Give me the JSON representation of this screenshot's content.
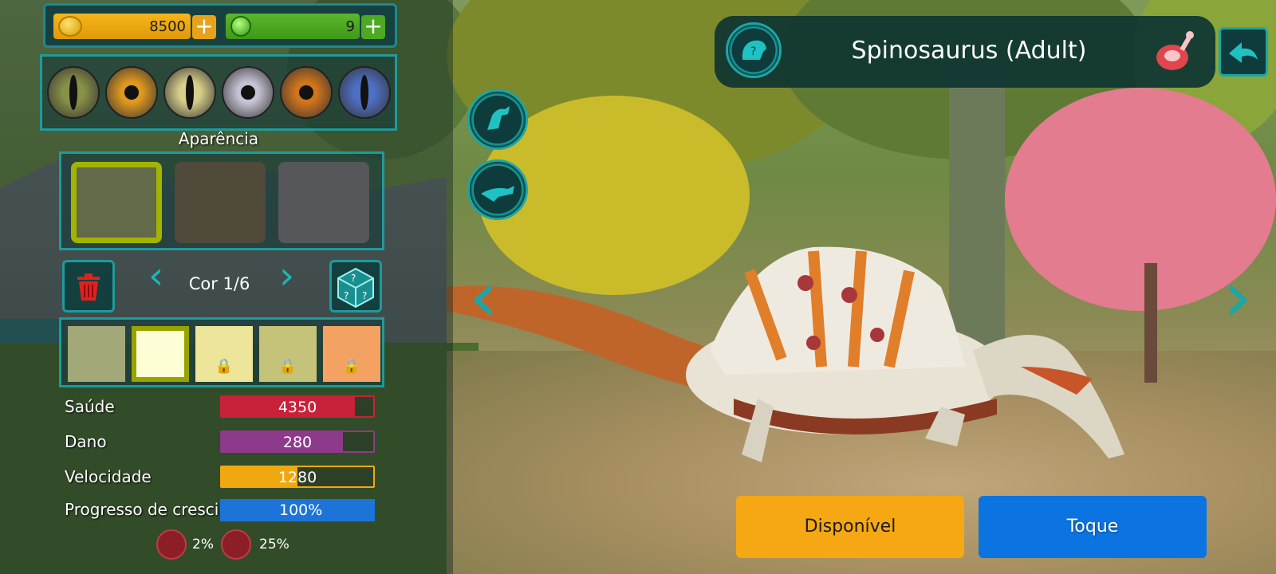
{
  "currency": {
    "gold_value": "8500",
    "gems_value": "9"
  },
  "appearance_title": "Aparência",
  "color_selector": {
    "label": "Cor 1/6"
  },
  "eyes": [
    {
      "iris": "#8a9146",
      "pupil": "slit"
    },
    {
      "iris": "#e0981e",
      "pupil": "round"
    },
    {
      "iris": "#d8cf8a",
      "pupil": "slit"
    },
    {
      "iris": "#c5c2d3",
      "pupil": "round"
    },
    {
      "iris": "#d2741c",
      "pupil": "round"
    },
    {
      "iris": "#4e6fc4",
      "pupil": "slit"
    }
  ],
  "patterns": [
    {
      "color": "#636a4a",
      "selected": true
    },
    {
      "color": "#4f4a3a",
      "selected": false
    },
    {
      "color": "#55575a",
      "selected": false
    }
  ],
  "swatches": [
    {
      "color": "#a3a878",
      "locked": false,
      "selected": false
    },
    {
      "color": "#fefed6",
      "locked": false,
      "selected": true
    },
    {
      "color": "#ece59a",
      "locked": true,
      "selected": false
    },
    {
      "color": "#c5c27a",
      "locked": true,
      "selected": false
    },
    {
      "color": "#f4a262",
      "locked": true,
      "selected": false
    }
  ],
  "stats": [
    {
      "label": "Saúde",
      "value": "4350",
      "fill_percent": 88,
      "color": "#c8223a",
      "border": "#c8223a"
    },
    {
      "label": "Dano",
      "value": "280",
      "fill_percent": 80,
      "color": "#8e3a8c",
      "border": "#8e3a8c"
    },
    {
      "label": "Velocidade",
      "value": "1280",
      "fill_percent": 50,
      "color": "#f0a810",
      "border": "#f0a810"
    }
  ],
  "growth": {
    "label": "Progresso de crescimento",
    "value": "100%",
    "fill_percent": 100
  },
  "bonus": {
    "first_pct": "2%",
    "second_pct": "25%"
  },
  "dino": {
    "title": "Spinosaurus (Adult)",
    "diet_icon": "meat-icon"
  },
  "buttons": {
    "available": "Disponível",
    "touch": "Toque"
  },
  "colors": {
    "accent_teal": "#1aa7a7",
    "gold": "#f5a813",
    "blue": "#0b74e0"
  }
}
